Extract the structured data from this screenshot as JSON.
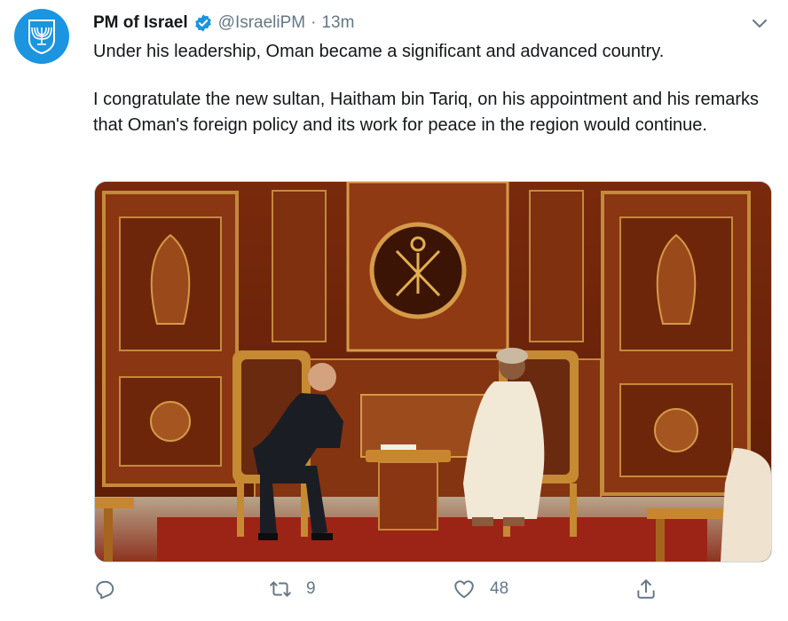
{
  "tweet": {
    "author_name": "PM of Israel",
    "handle": "@IsraeliPM",
    "separator": "·",
    "time": "13m",
    "paragraphs": [
      "Under his leadership, Oman became a significant and advanced country.",
      "I congratulate the new sultan, Haitham bin Tariq, on his appointment and his remarks that Oman's foreign policy and its work for peace in the region would continue."
    ]
  },
  "icons": {
    "avatar": "menorah-emblem-icon",
    "verified": "verified-badge-icon",
    "more": "chevron-down-icon",
    "reply": "reply-icon",
    "retweet": "retweet-icon",
    "like": "heart-icon",
    "share": "share-icon"
  },
  "actions": {
    "retweet_count": "9",
    "like_count": "48"
  },
  "colors": {
    "accent": "#1b95e0",
    "muted": "#657786",
    "text": "#14171a"
  }
}
